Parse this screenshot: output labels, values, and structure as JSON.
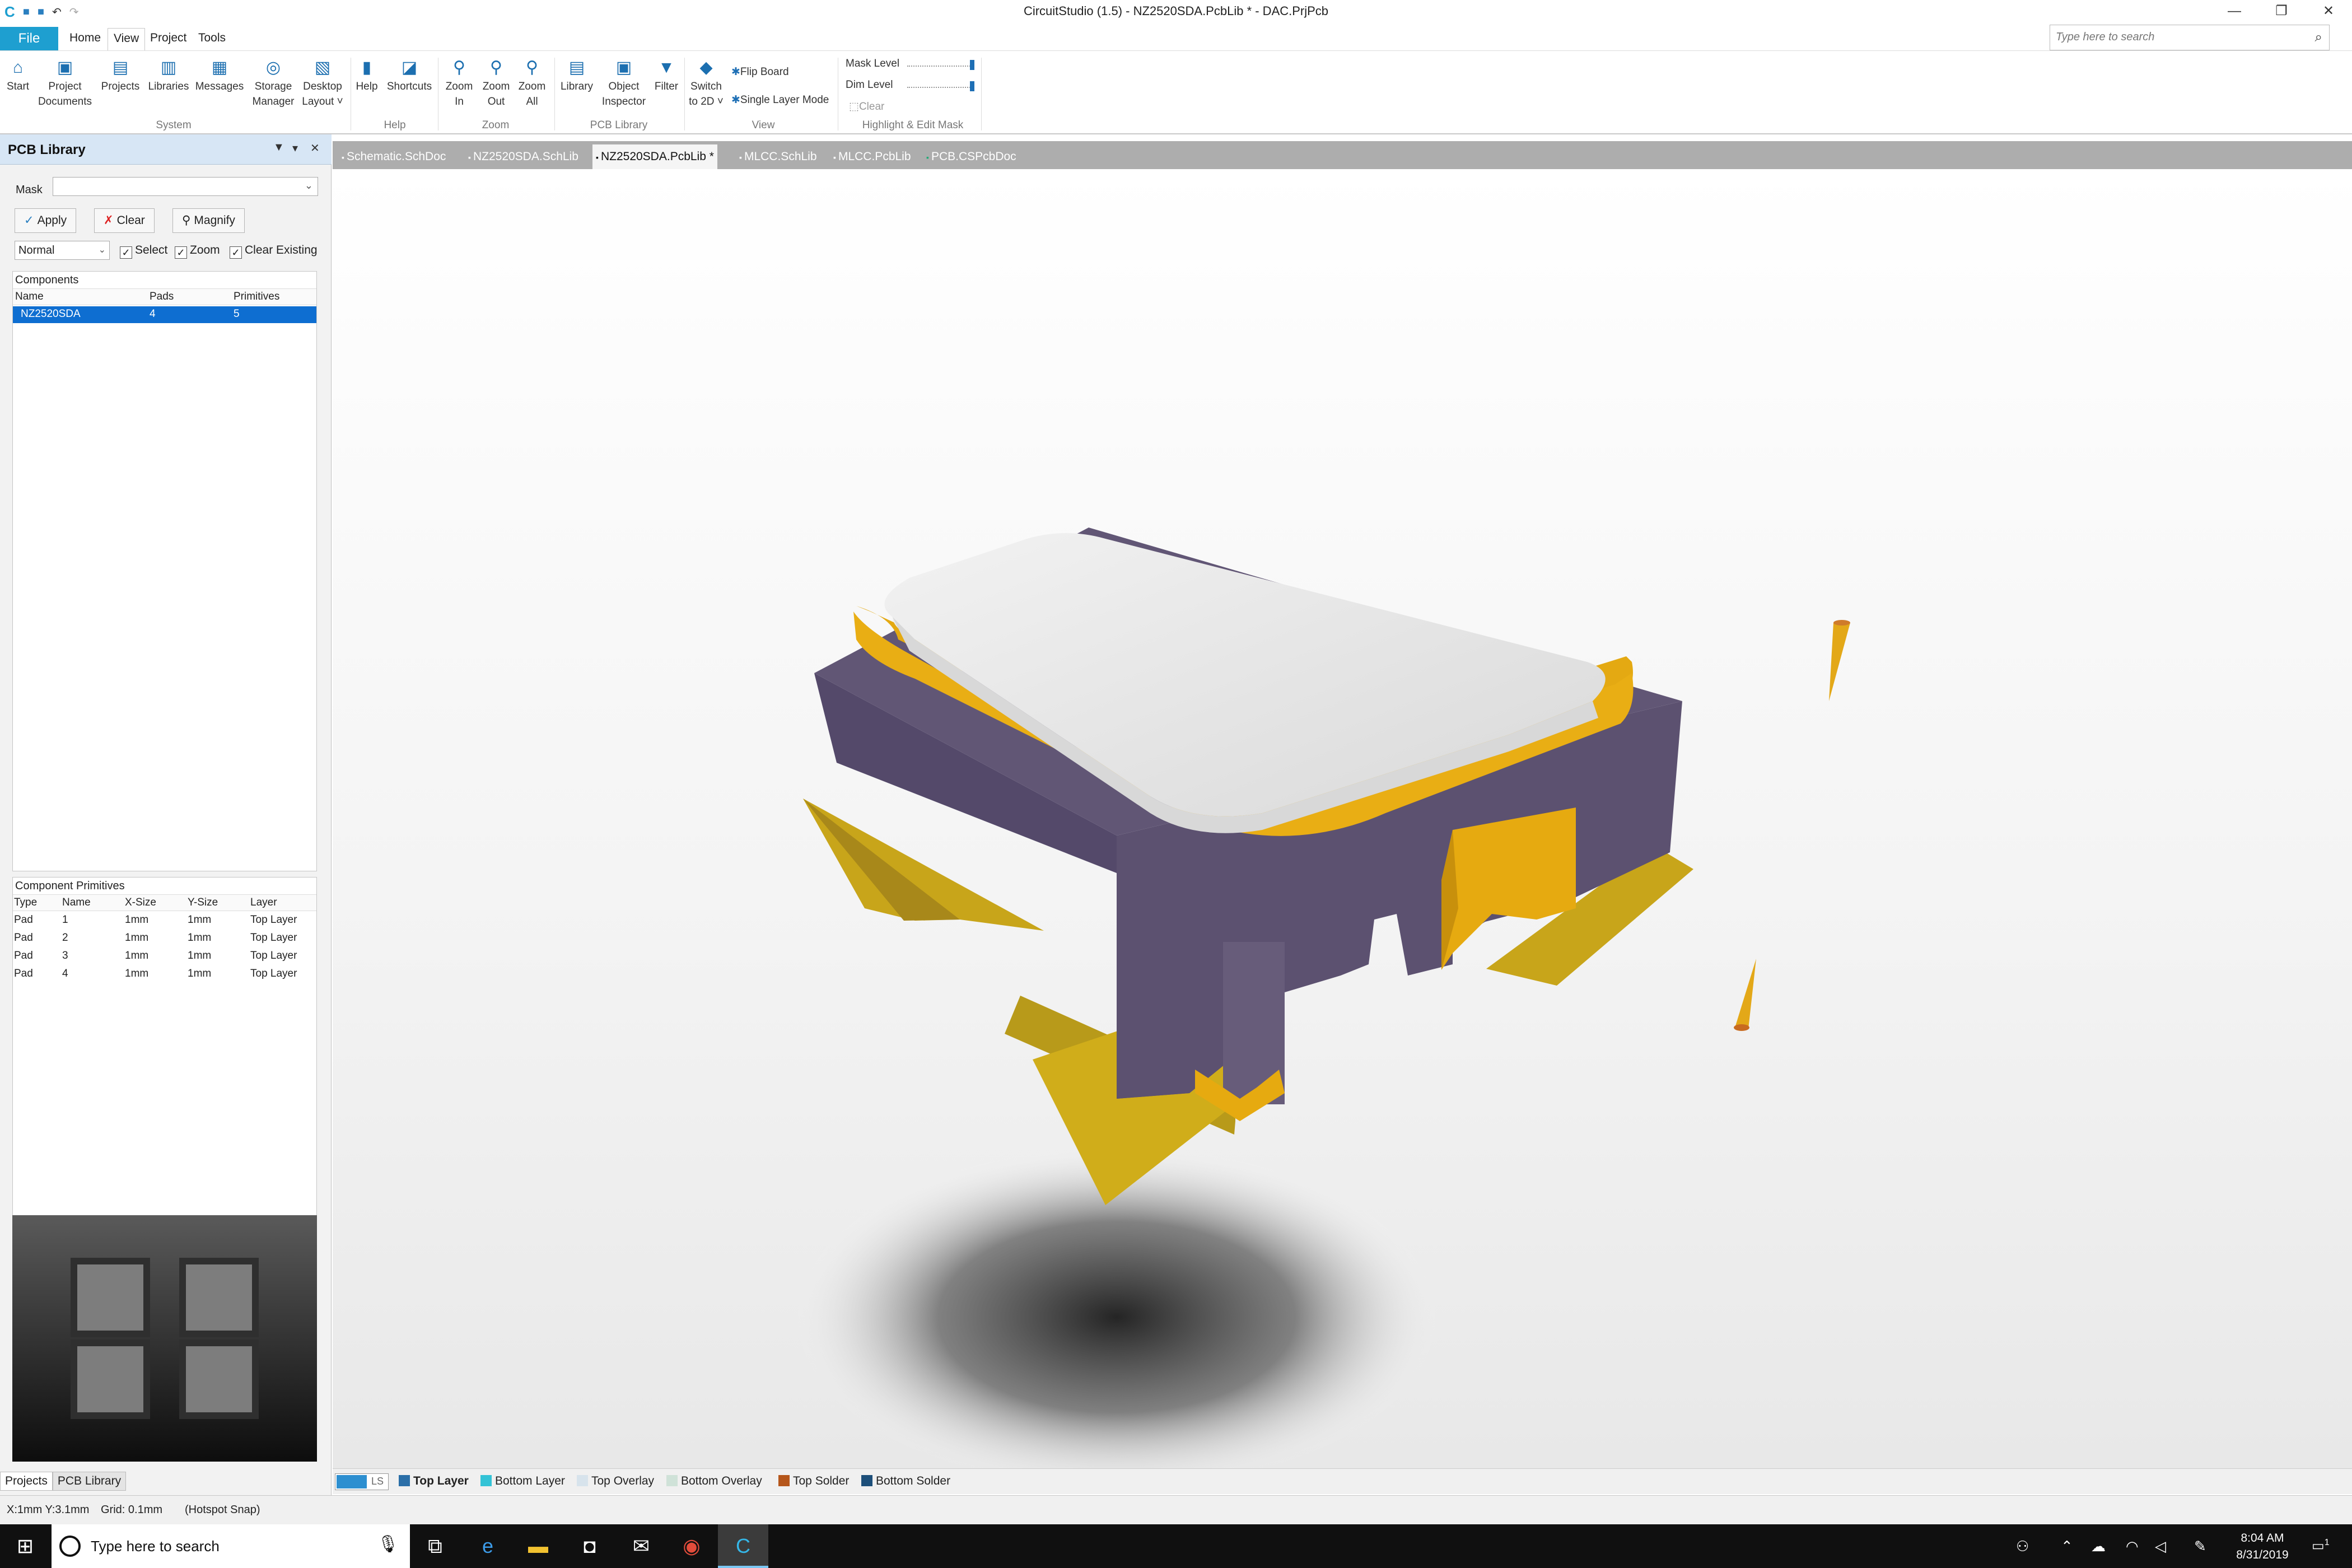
{
  "window": {
    "title": "CircuitStudio (1.5) - NZ2520SDA.PcbLib * - DAC.PrjPcb",
    "minimize": "—",
    "restore": "❐",
    "close": "✕"
  },
  "quick_access": {
    "app_icon": "C",
    "save": "■",
    "save_all": "■",
    "undo": "↶",
    "redo": "↷"
  },
  "menu": {
    "file": "File",
    "tabs": [
      "Home",
      "View",
      "Project",
      "Tools"
    ],
    "active_tab": "View"
  },
  "search": {
    "placeholder": "Type here to search",
    "icon": "⌕"
  },
  "ribbon": {
    "buttons": [
      {
        "label1": "Start",
        "label2": "",
        "icon": "⌂"
      },
      {
        "label1": "Project",
        "label2": "Documents",
        "icon": "▣"
      },
      {
        "label1": "Projects",
        "label2": "",
        "icon": "▤"
      },
      {
        "label1": "Libraries",
        "label2": "",
        "icon": "▥"
      },
      {
        "label1": "Messages",
        "label2": "",
        "icon": "▦"
      },
      {
        "label1": "Storage",
        "label2": "Manager",
        "icon": "◎"
      },
      {
        "label1": "Desktop",
        "label2": "Layout ˅",
        "icon": "▧"
      },
      {
        "label1": "Help",
        "label2": "",
        "icon": "▮"
      },
      {
        "label1": "Shortcuts",
        "label2": "",
        "icon": "◪"
      },
      {
        "label1": "Zoom",
        "label2": "In",
        "icon": "⚲"
      },
      {
        "label1": "Zoom",
        "label2": "Out",
        "icon": "⚲"
      },
      {
        "label1": "Zoom",
        "label2": "All",
        "icon": "⚲"
      },
      {
        "label1": "Library",
        "label2": "",
        "icon": "▤"
      },
      {
        "label1": "Object",
        "label2": "Inspector",
        "icon": "▣"
      },
      {
        "label1": "Filter",
        "label2": "",
        "icon": "▼"
      },
      {
        "label1": "Switch",
        "label2": "to 2D ˅",
        "icon": "◆"
      }
    ],
    "groups": [
      "System",
      "Help",
      "Zoom",
      "PCB Library",
      "View",
      "Highlight & Edit Mask"
    ],
    "flip_board": "Flip Board",
    "single_layer_mode": "Single Layer Mode",
    "mask_level": "Mask Level",
    "dim_level": "Dim Level",
    "clear": "Clear"
  },
  "panel": {
    "title": "PCB Library",
    "controls": {
      "menu": "▼",
      "pin": "▾",
      "close": "✕"
    },
    "mask_label": "Mask",
    "mask_value": "",
    "apply": "Apply",
    "clear": "Clear",
    "magnify": "Magnify",
    "mode": "Normal",
    "select": "Select",
    "zoom": "Zoom",
    "clear_existing": "Clear Existing",
    "components_caption": "Components",
    "components_headers": [
      "Name",
      "Pads",
      "Primitives"
    ],
    "components": [
      {
        "name": "NZ2520SDA",
        "pads": "4",
        "primitives": "5"
      }
    ],
    "primitives_caption": "Component Primitives",
    "primitives_headers": [
      "Type",
      "Name",
      "X-Size",
      "Y-Size",
      "Layer"
    ],
    "primitives": [
      {
        "type": "Pad",
        "name": "1",
        "x": "1mm",
        "y": "1mm",
        "layer": "Top Layer"
      },
      {
        "type": "Pad",
        "name": "2",
        "x": "1mm",
        "y": "1mm",
        "layer": "Top Layer"
      },
      {
        "type": "Pad",
        "name": "3",
        "x": "1mm",
        "y": "1mm",
        "layer": "Top Layer"
      },
      {
        "type": "Pad",
        "name": "4",
        "x": "1mm",
        "y": "1mm",
        "layer": "Top Layer"
      }
    ],
    "bottom_tabs": [
      "Projects",
      "PCB Library"
    ]
  },
  "doc_tabs": [
    {
      "label": "Schematic.SchDoc",
      "active": false
    },
    {
      "label": "NZ2520SDA.SchLib",
      "active": false
    },
    {
      "label": "NZ2520SDA.PcbLib *",
      "active": true
    },
    {
      "label": "MLCC.SchLib",
      "active": false
    },
    {
      "label": "MLCC.PcbLib",
      "active": false
    },
    {
      "label": "PCB.CSPcbDoc",
      "active": false
    }
  ],
  "layers": {
    "ls": "LS",
    "items": [
      {
        "label": "Top Layer",
        "color": "#2b6fa8",
        "bold": true
      },
      {
        "label": "Bottom Layer",
        "color": "#33c3d6",
        "bold": false
      },
      {
        "label": "Top Overlay",
        "color": "#d7e3ec",
        "bold": false
      },
      {
        "label": "Bottom Overlay",
        "color": "#cfe2d8",
        "bold": false
      },
      {
        "label": "Top Solder",
        "color": "#b5561b",
        "bold": false
      },
      {
        "label": "Bottom Solder",
        "color": "#1d4f7a",
        "bold": false
      }
    ]
  },
  "status": {
    "coords": "X:1mm Y:3.1mm",
    "grid": "Grid: 0.1mm",
    "snap": "(Hotspot Snap)"
  },
  "colors": {
    "accent": "#1e9fd0",
    "body": "#5a5068",
    "lid": "#e6e6e6",
    "ring": "#e8ac12",
    "pads": "#c4a21a"
  },
  "taskbar": {
    "search_text": "Type here to search",
    "time": "8:04 AM",
    "date": "8/31/2019",
    "notifications": "1"
  }
}
